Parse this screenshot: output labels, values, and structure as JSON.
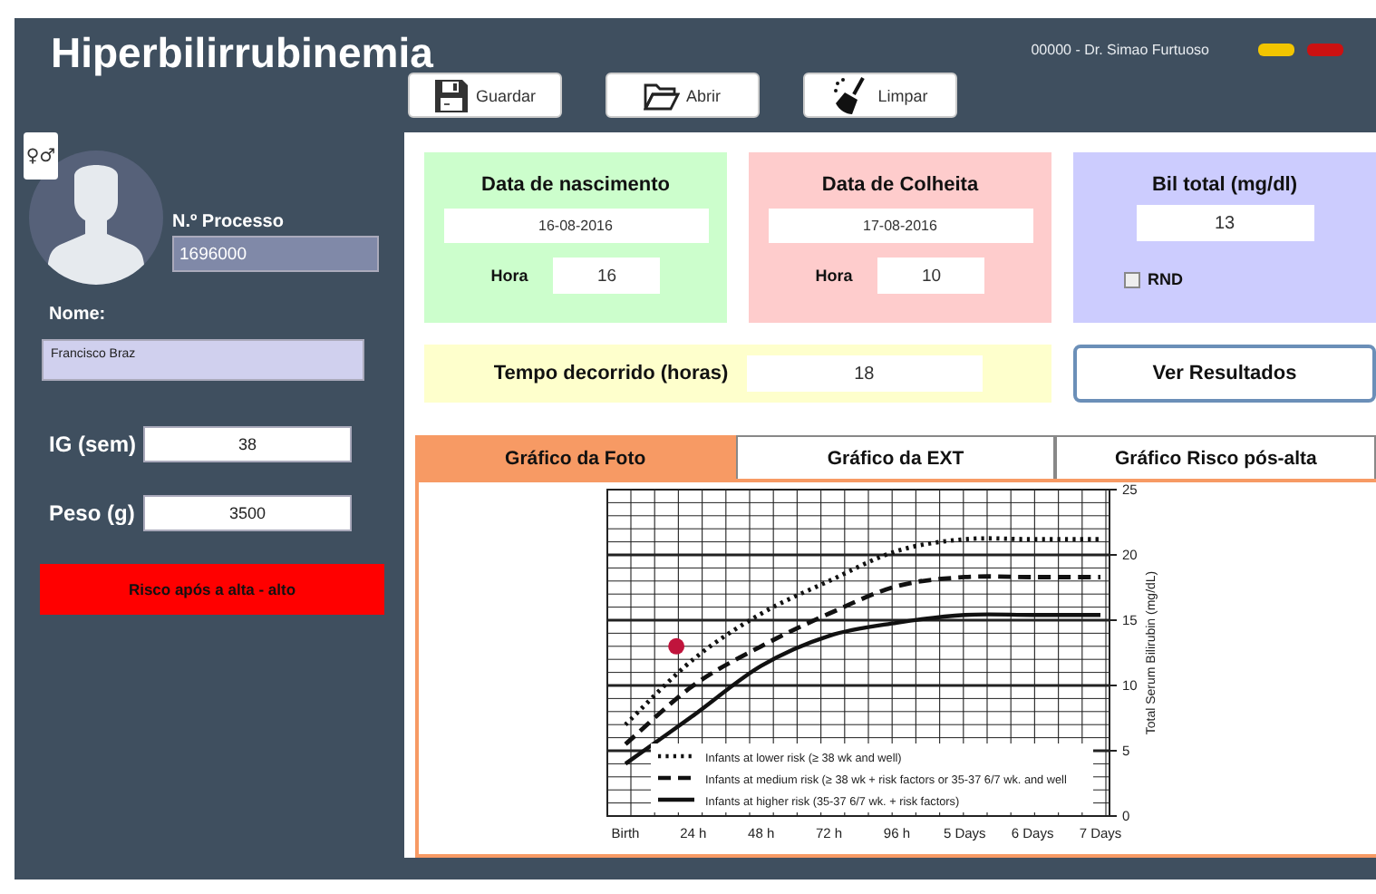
{
  "app": {
    "title": "Hiperbilirrubinemia",
    "user": "00000 - Dr. Simao Furtuoso",
    "indicators": [
      {
        "color": "#f2c500"
      },
      {
        "color": "#cc1111"
      }
    ]
  },
  "toolbar": [
    {
      "kind": "save",
      "label": "Guardar"
    },
    {
      "kind": "open",
      "label": "Abrir"
    },
    {
      "kind": "clear",
      "label": "Limpar"
    }
  ],
  "patient": {
    "gender_button": "♀♂",
    "process_label": "N.º Processo",
    "process": "1696000",
    "name_label": "Nome:",
    "name": "Francisco Braz",
    "ga_label": "IG (sem)",
    "ga": "38",
    "weight_label": "Peso (g)",
    "weight": "3500",
    "risk": "Risco após a alta - alto"
  },
  "birth": {
    "title": "Data de nascimento",
    "date": "16-08-2016",
    "hour_label": "Hora",
    "hour": "16"
  },
  "collection": {
    "title": "Data de Colheita",
    "date": "17-08-2016",
    "hour_label": "Hora",
    "hour": "10"
  },
  "bilirubin": {
    "title": "Bil total (mg/dl)",
    "value": "13",
    "rnd_label": "RND",
    "rnd_checked": false
  },
  "elapsed": {
    "label": "Tempo decorrido (horas)",
    "value": "18"
  },
  "results_button": "Ver Resultados",
  "tabs": [
    {
      "label": "Gráfico da Foto",
      "selected": true
    },
    {
      "label": "Gráfico da EXT",
      "selected": false
    },
    {
      "label": "Gráfico Risco pós-alta",
      "selected": false
    }
  ],
  "chart_data": {
    "type": "line",
    "ylabel": "Total Serum Bilirubin (mg/dL)",
    "categories": [
      "Birth",
      "24 h",
      "48 h",
      "72 h",
      "96 h",
      "5 Days",
      "6 Days",
      "7 Days"
    ],
    "ylim": [
      0,
      25
    ],
    "yticks": [
      0,
      5,
      10,
      15,
      20,
      25
    ],
    "grid": true,
    "legend": "lower left",
    "series": [
      {
        "name": "Infants at lower risk (≥ 38 wk and well)",
        "color": "#111111",
        "line_style": "dotted",
        "values": [
          7,
          12,
          15.5,
          18,
          20.3,
          21.2,
          21.2,
          21.2
        ]
      },
      {
        "name": "Infants at medium risk (≥ 38 wk + risk factors or 35-37 6/7 wk. and well",
        "color": "#111111",
        "line_style": "dashed",
        "values": [
          5.5,
          10,
          13,
          15.5,
          17.6,
          18.3,
          18.3,
          18.3
        ]
      },
      {
        "name": "Infants at higher risk (35-37 6/7 wk. + risk factors)",
        "color": "#111111",
        "line_style": "solid",
        "values": [
          4,
          7.7,
          11.5,
          13.8,
          14.8,
          15.4,
          15.4,
          15.4
        ]
      }
    ]
  }
}
